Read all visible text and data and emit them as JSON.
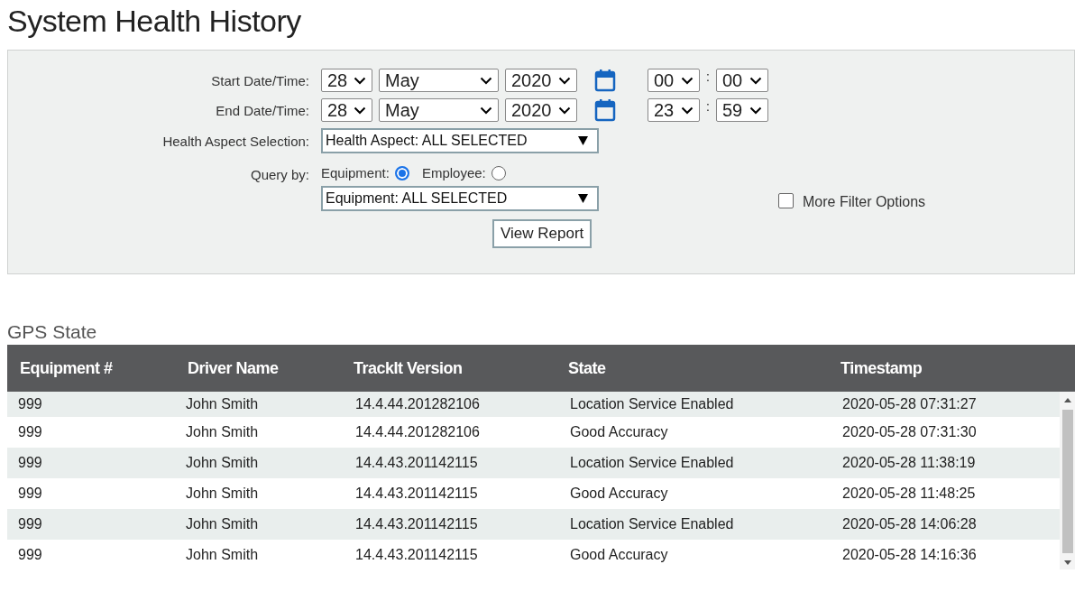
{
  "title": "System Health History",
  "filters": {
    "start": {
      "label": "Start Date/Time:",
      "day": "28",
      "month": "May",
      "year": "2020",
      "hour": "00",
      "minute": "00"
    },
    "end": {
      "label": "End Date/Time:",
      "day": "28",
      "month": "May",
      "year": "2020",
      "hour": "23",
      "minute": "59"
    },
    "time_separator": ":",
    "health_aspect": {
      "label": "Health Aspect Selection:",
      "value": "Health Aspect: ALL SELECTED"
    },
    "query_by": {
      "label": "Query by:",
      "options": [
        {
          "label": "Equipment:",
          "selected": true
        },
        {
          "label": "Employee:",
          "selected": false
        }
      ]
    },
    "equipment_select": {
      "value": "Equipment: ALL SELECTED"
    },
    "more_filter_options": {
      "label": "More Filter Options",
      "checked": false
    },
    "view_report_button": "View Report"
  },
  "gps_state": {
    "title": "GPS State",
    "columns": [
      "Equipment #",
      "Driver Name",
      "TrackIt Version",
      "State",
      "Timestamp"
    ],
    "rows": [
      [
        "999",
        "John Smith",
        "14.4.44.201282106",
        "Location Service Enabled",
        "2020-05-28 07:31:27"
      ],
      [
        "999",
        "John Smith",
        "14.4.44.201282106",
        "Good Accuracy",
        "2020-05-28 07:31:30"
      ],
      [
        "999",
        "John Smith",
        "14.4.43.201142115",
        "Location Service Enabled",
        "2020-05-28 11:38:19"
      ],
      [
        "999",
        "John Smith",
        "14.4.43.201142115",
        "Good Accuracy",
        "2020-05-28 11:48:25"
      ],
      [
        "999",
        "John Smith",
        "14.4.43.201142115",
        "Location Service Enabled",
        "2020-05-28 14:06:28"
      ],
      [
        "999",
        "John Smith",
        "14.4.43.201142115",
        "Good Accuracy",
        "2020-05-28 14:16:36"
      ]
    ]
  }
}
